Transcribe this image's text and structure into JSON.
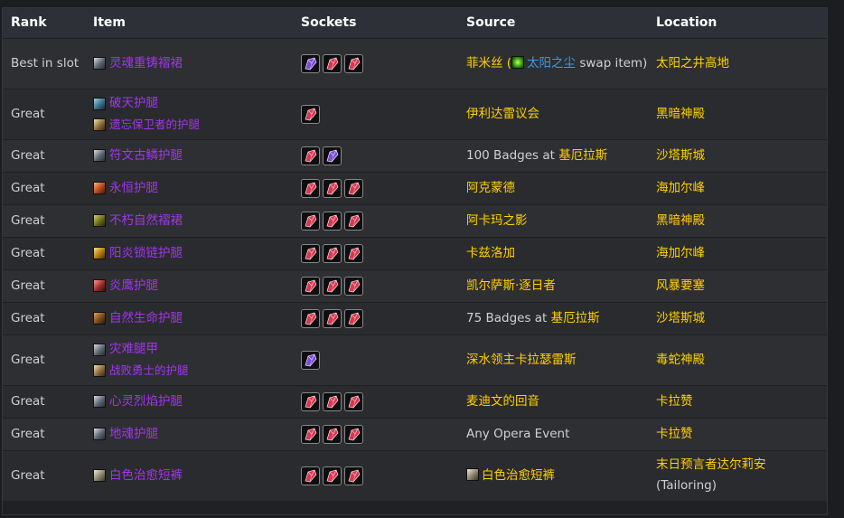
{
  "headers": {
    "rank": "Rank",
    "item": "Item",
    "sockets": "Sockets",
    "source": "Source",
    "location": "Location"
  },
  "colors": {
    "epic": "#a335ee",
    "gold": "#ffd100",
    "link": "#3a9be0",
    "gem_red": "#d9364f",
    "gem_purple": "#7a4ad8"
  },
  "rows": [
    {
      "rank": "Best in slot",
      "items": [
        {
          "name": "灵魂重铸褶裙",
          "icon": "cloth-legs-icon"
        }
      ],
      "sockets": [
        "purple",
        "red",
        "red"
      ],
      "source": {
        "parts": [
          {
            "text": "菲米丝 (",
            "style": "gold"
          },
          {
            "icon": "sunwell-dust-icon"
          },
          {
            "text": "太阳之尘",
            "style": "blue"
          },
          {
            "text": " swap item)",
            "style": "plain"
          }
        ]
      },
      "location": "太阳之井高地"
    },
    {
      "rank": "Great",
      "items": [
        {
          "name": "破天护腿",
          "icon": "mail-legs-icon"
        },
        {
          "name": "遗忘保卫者的护腿",
          "icon": "tier-token-icon"
        }
      ],
      "sockets": [
        "red"
      ],
      "source": {
        "parts": [
          {
            "text": "伊利达雷议会",
            "style": "gold"
          }
        ]
      },
      "location": "黑暗神殿"
    },
    {
      "rank": "Great",
      "items": [
        {
          "name": "符文古鳞护腿",
          "icon": "cloth-legs-icon"
        }
      ],
      "sockets": [
        "red",
        "purple"
      ],
      "source": {
        "parts": [
          {
            "text": "100 Badges at ",
            "style": "plain"
          },
          {
            "text": "基厄拉斯",
            "style": "gold"
          }
        ]
      },
      "location": "沙塔斯城"
    },
    {
      "rank": "Great",
      "items": [
        {
          "name": "永恒护腿",
          "icon": "leather-legs-icon"
        }
      ],
      "sockets": [
        "red",
        "red",
        "red"
      ],
      "source": {
        "parts": [
          {
            "text": "阿克蒙德",
            "style": "gold"
          }
        ]
      },
      "location": "海加尔峰"
    },
    {
      "rank": "Great",
      "items": [
        {
          "name": "不朽自然褶裙",
          "icon": "nature-skirt-icon"
        }
      ],
      "sockets": [
        "red",
        "red",
        "red"
      ],
      "source": {
        "parts": [
          {
            "text": "阿卡玛之影",
            "style": "gold"
          }
        ]
      },
      "location": "黑暗神殿"
    },
    {
      "rank": "Great",
      "items": [
        {
          "name": "阳炎锁链护腿",
          "icon": "gold-mail-icon"
        }
      ],
      "sockets": [
        "red",
        "red",
        "red"
      ],
      "source": {
        "parts": [
          {
            "text": "卡兹洛加",
            "style": "gold"
          }
        ]
      },
      "location": "海加尔峰"
    },
    {
      "rank": "Great",
      "items": [
        {
          "name": "炎鹰护腿",
          "icon": "red-legs-icon"
        }
      ],
      "sockets": [
        "red",
        "red",
        "red"
      ],
      "source": {
        "parts": [
          {
            "text": "凯尔萨斯·逐日者",
            "style": "gold"
          }
        ]
      },
      "location": "风暴要塞"
    },
    {
      "rank": "Great",
      "items": [
        {
          "name": "自然生命护腿",
          "icon": "wood-legs-icon"
        }
      ],
      "sockets": [
        "red",
        "red",
        "red"
      ],
      "source": {
        "parts": [
          {
            "text": "75 Badges at ",
            "style": "plain"
          },
          {
            "text": "基厄拉斯",
            "style": "gold"
          }
        ]
      },
      "location": "沙塔斯城"
    },
    {
      "rank": "Great",
      "items": [
        {
          "name": "灾难腿甲",
          "icon": "cloth-legs-icon"
        },
        {
          "name": "战败勇士的护腿",
          "icon": "tier-token-icon"
        }
      ],
      "sockets": [
        "purple"
      ],
      "source": {
        "parts": [
          {
            "text": "深水领主卡拉瑟雷斯",
            "style": "gold"
          }
        ]
      },
      "location": "毒蛇神殿"
    },
    {
      "rank": "Great",
      "items": [
        {
          "name": "心灵烈焰护腿",
          "icon": "cloth-legs-icon"
        }
      ],
      "sockets": [
        "red",
        "red",
        "red"
      ],
      "source": {
        "parts": [
          {
            "text": "麦迪文的回音",
            "style": "gold"
          }
        ]
      },
      "location": "卡拉赞"
    },
    {
      "rank": "Great",
      "items": [
        {
          "name": "地魂护腿",
          "icon": "cloth-legs-icon"
        }
      ],
      "sockets": [
        "red",
        "red",
        "red"
      ],
      "source": {
        "parts": [
          {
            "text": "Any Opera Event",
            "style": "plain"
          }
        ]
      },
      "location": "卡拉赞"
    },
    {
      "rank": "Great",
      "items": [
        {
          "name": "白色治愈短裤",
          "icon": "white-shorts-icon"
        }
      ],
      "sockets": [
        "red",
        "red",
        "red"
      ],
      "source": {
        "parts": [
          {
            "icon": "white-shorts-icon"
          },
          {
            "text": "白色治愈短裤",
            "style": "gold"
          }
        ]
      },
      "location": "末日预言者达尔莉安 (Tailoring)"
    }
  ]
}
